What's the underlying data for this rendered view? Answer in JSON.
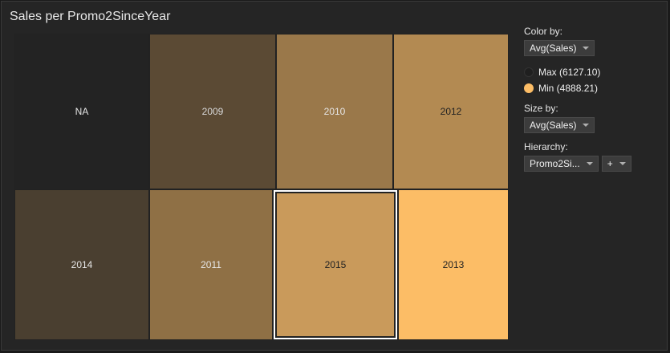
{
  "title": "Sales per Promo2SinceYear",
  "color_by": {
    "label": "Color by:",
    "value": "Avg(Sales)"
  },
  "legend": {
    "max_label": "Max (6127.10)",
    "max_color": "#1f1f1f",
    "min_label": "Min (4888.21)",
    "min_color": "#fcbd66"
  },
  "size_by": {
    "label": "Size by:",
    "value": "Avg(Sales)"
  },
  "hierarchy": {
    "label": "Hierarchy:",
    "value": "Promo2Si...",
    "add_label": "+"
  },
  "cells": [
    {
      "label": "NA",
      "bg": "#232323",
      "fg": "#e6e6e6"
    },
    {
      "label": "2009",
      "bg": "#5b4a34",
      "fg": "#d8d8d8"
    },
    {
      "label": "2010",
      "bg": "#9a784a",
      "fg": "#e6e6e6"
    },
    {
      "label": "2012",
      "bg": "#b38a52",
      "fg": "#222222"
    },
    {
      "label": "2014",
      "bg": "#4a3f30",
      "fg": "#e6e6e6"
    },
    {
      "label": "2011",
      "bg": "#8f7045",
      "fg": "#e6e6e6"
    },
    {
      "label": "2015",
      "bg": "#c99a5b",
      "fg": "#222222"
    },
    {
      "label": "2013",
      "bg": "#fcbd66",
      "fg": "#222222"
    }
  ]
}
